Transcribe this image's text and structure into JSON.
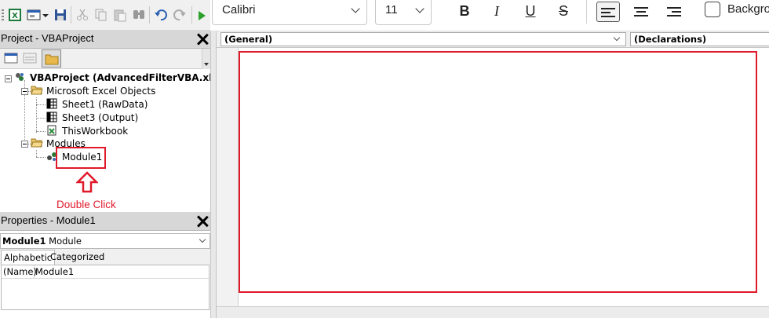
{
  "format_toolbar": {
    "font_name": "Calibri",
    "font_size": "11",
    "bold_label": "B",
    "italic_label": "I",
    "underline_label": "U",
    "strike_label": "S",
    "background_label": "Backgro"
  },
  "project_pane": {
    "title": "Project - VBAProject",
    "tree": {
      "root": "VBAProject (AdvancedFilterVBA.xlsm)",
      "excel_objects_folder": "Microsoft Excel Objects",
      "sheet1": "Sheet1 (RawData)",
      "sheet3": "Sheet3 (Output)",
      "workbook": "ThisWorkbook",
      "modules_folder": "Modules",
      "module1": "Module1"
    }
  },
  "annotation": {
    "label": "Double Click",
    "color": "#e0192a"
  },
  "properties_pane": {
    "title": "Properties - Module1",
    "object_name": "Module1",
    "object_type": "Module",
    "tabs": [
      "Alphabetic",
      "Categorized"
    ],
    "rows": [
      {
        "name": "(Name)",
        "value": "Module1"
      }
    ]
  },
  "code_window": {
    "object_dropdown": "(General)",
    "procedure_dropdown": "(Declarations)"
  }
}
